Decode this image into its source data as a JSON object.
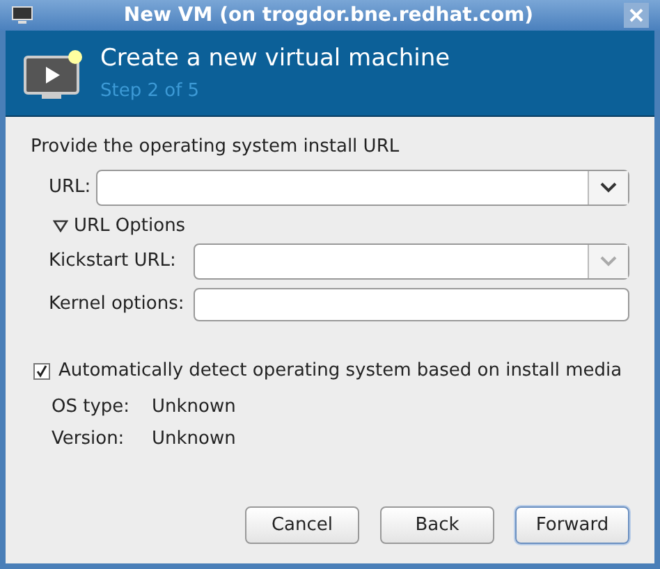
{
  "window": {
    "title": "New VM (on trogdor.bne.redhat.com)"
  },
  "header": {
    "title": "Create a new virtual machine",
    "step": "Step 2 of 5"
  },
  "section_title": "Provide the operating system install URL",
  "url": {
    "label": "URL:"
  },
  "url_options": {
    "label": "URL Options",
    "expanded": true
  },
  "kickstart": {
    "label": "Kickstart URL:"
  },
  "kernel": {
    "label": "Kernel options:"
  },
  "autodetect": {
    "label": "Automatically detect operating system based on install media",
    "checked": true
  },
  "os_info": [
    {
      "label": "OS type:",
      "value": "Unknown"
    },
    {
      "label": "Version:",
      "value": "Unknown"
    }
  ],
  "buttons": [
    {
      "label": "Cancel",
      "focused": false
    },
    {
      "label": "Back",
      "focused": false
    },
    {
      "label": "Forward",
      "focused": true
    }
  ]
}
